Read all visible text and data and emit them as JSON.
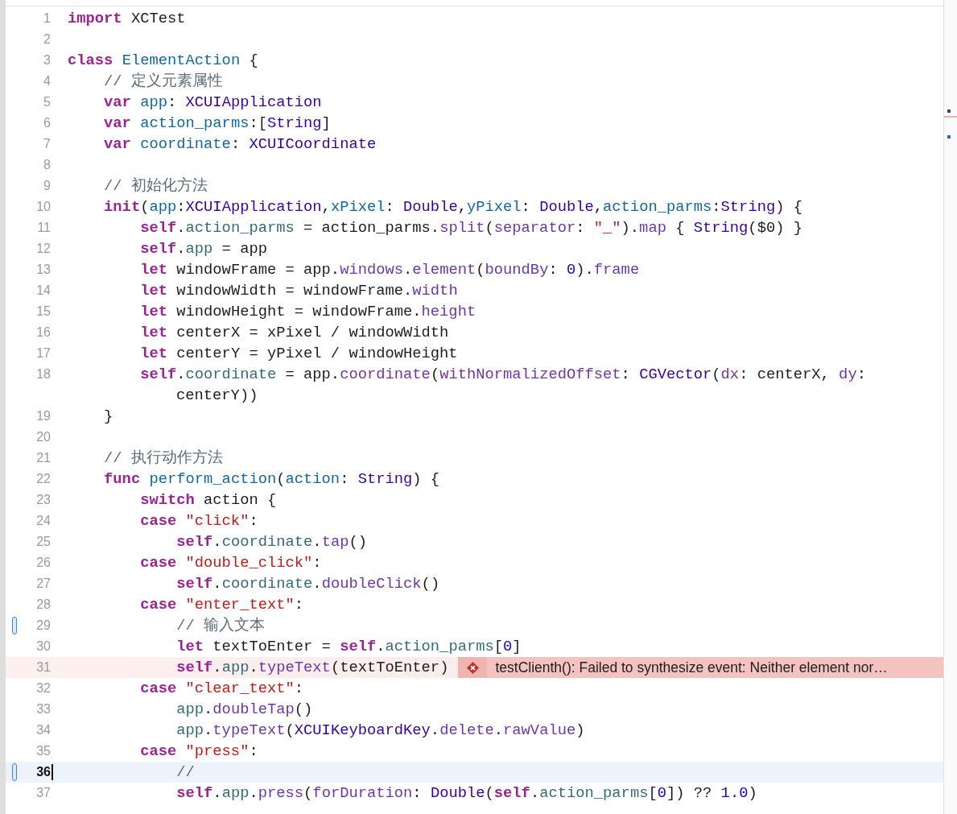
{
  "editor": {
    "lines": [
      {
        "number": "1",
        "changed": false,
        "current": false,
        "tokens": [
          {
            "kind": "keyword",
            "text": "import"
          },
          {
            "kind": "plain",
            "text": " XCTest"
          }
        ]
      },
      {
        "number": "2",
        "changed": false,
        "current": false
      },
      {
        "number": "3",
        "changed": false,
        "current": false,
        "tokens": [
          {
            "kind": "keyword",
            "text": "class"
          },
          {
            "kind": "decl",
            "text": " ElementAction"
          },
          {
            "kind": "plain",
            "text": " {"
          }
        ]
      },
      {
        "number": "4",
        "changed": false,
        "current": false,
        "tokens": [
          {
            "kind": "comment",
            "text": "    // 定义元素属性"
          }
        ]
      },
      {
        "number": "5",
        "changed": false,
        "current": false,
        "tokens": [
          {
            "kind": "keyword",
            "text": "    var"
          },
          {
            "kind": "decl",
            "text": " app"
          },
          {
            "kind": "plain",
            "text": ": "
          },
          {
            "kind": "type",
            "text": "XCUIApplication"
          }
        ]
      },
      {
        "number": "6",
        "changed": false,
        "current": false,
        "tokens": [
          {
            "kind": "keyword",
            "text": "    var"
          },
          {
            "kind": "decl",
            "text": " action_parms"
          },
          {
            "kind": "plain",
            "text": ":["
          },
          {
            "kind": "type",
            "text": "String"
          },
          {
            "kind": "plain",
            "text": "]"
          }
        ]
      },
      {
        "number": "7",
        "changed": false,
        "current": false,
        "tokens": [
          {
            "kind": "keyword",
            "text": "    var"
          },
          {
            "kind": "decl",
            "text": " coordinate"
          },
          {
            "kind": "plain",
            "text": ": "
          },
          {
            "kind": "type",
            "text": "XCUICoordinate"
          }
        ]
      },
      {
        "number": "8",
        "changed": false,
        "current": false
      },
      {
        "number": "9",
        "changed": false,
        "current": false,
        "tokens": [
          {
            "kind": "comment",
            "text": "    // 初始化方法"
          }
        ]
      },
      {
        "number": "10",
        "changed": false,
        "current": false,
        "tokens": [
          {
            "kind": "keyword",
            "text": "    init"
          },
          {
            "kind": "plain",
            "text": "("
          },
          {
            "kind": "decl",
            "text": "app"
          },
          {
            "kind": "plain",
            "text": ":"
          },
          {
            "kind": "type",
            "text": "XCUIApplication"
          },
          {
            "kind": "plain",
            "text": ","
          },
          {
            "kind": "decl",
            "text": "xPixel"
          },
          {
            "kind": "plain",
            "text": ": "
          },
          {
            "kind": "type",
            "text": "Double"
          },
          {
            "kind": "plain",
            "text": ","
          },
          {
            "kind": "decl",
            "text": "yPixel"
          },
          {
            "kind": "plain",
            "text": ": "
          },
          {
            "kind": "type",
            "text": "Double"
          },
          {
            "kind": "plain",
            "text": ","
          },
          {
            "kind": "decl",
            "text": "action_parms"
          },
          {
            "kind": "plain",
            "text": ":"
          },
          {
            "kind": "type",
            "text": "String"
          },
          {
            "kind": "plain",
            "text": ") {"
          }
        ]
      },
      {
        "number": "11",
        "changed": false,
        "current": false,
        "tokens": [
          {
            "kind": "keyword",
            "text": "        self"
          },
          {
            "kind": "plain",
            "text": "."
          },
          {
            "kind": "member",
            "text": "action_parms"
          },
          {
            "kind": "plain",
            "text": " = action_parms."
          },
          {
            "kind": "api",
            "text": "split"
          },
          {
            "kind": "plain",
            "text": "("
          },
          {
            "kind": "api",
            "text": "separator"
          },
          {
            "kind": "plain",
            "text": ": "
          },
          {
            "kind": "string",
            "text": "\"_\""
          },
          {
            "kind": "plain",
            "text": ")."
          },
          {
            "kind": "api",
            "text": "map"
          },
          {
            "kind": "plain",
            "text": " { "
          },
          {
            "kind": "type",
            "text": "String"
          },
          {
            "kind": "plain",
            "text": "($0) }"
          }
        ]
      },
      {
        "number": "12",
        "changed": false,
        "current": false,
        "tokens": [
          {
            "kind": "keyword",
            "text": "        self"
          },
          {
            "kind": "plain",
            "text": "."
          },
          {
            "kind": "member",
            "text": "app"
          },
          {
            "kind": "plain",
            "text": " = app"
          }
        ]
      },
      {
        "number": "13",
        "changed": false,
        "current": false,
        "tokens": [
          {
            "kind": "keyword",
            "text": "        let"
          },
          {
            "kind": "plain",
            "text": " windowFrame = app."
          },
          {
            "kind": "api",
            "text": "windows"
          },
          {
            "kind": "plain",
            "text": "."
          },
          {
            "kind": "api",
            "text": "element"
          },
          {
            "kind": "plain",
            "text": "("
          },
          {
            "kind": "api",
            "text": "boundBy"
          },
          {
            "kind": "plain",
            "text": ": "
          },
          {
            "kind": "number",
            "text": "0"
          },
          {
            "kind": "plain",
            "text": ")."
          },
          {
            "kind": "api",
            "text": "frame"
          }
        ]
      },
      {
        "number": "14",
        "changed": false,
        "current": false,
        "tokens": [
          {
            "kind": "keyword",
            "text": "        let"
          },
          {
            "kind": "plain",
            "text": " windowWidth = windowFrame."
          },
          {
            "kind": "api",
            "text": "width"
          }
        ]
      },
      {
        "number": "15",
        "changed": false,
        "current": false,
        "tokens": [
          {
            "kind": "keyword",
            "text": "        let"
          },
          {
            "kind": "plain",
            "text": " windowHeight = windowFrame."
          },
          {
            "kind": "api",
            "text": "height"
          }
        ]
      },
      {
        "number": "16",
        "changed": false,
        "current": false,
        "tokens": [
          {
            "kind": "keyword",
            "text": "        let"
          },
          {
            "kind": "plain",
            "text": " centerX = xPixel / windowWidth"
          }
        ]
      },
      {
        "number": "17",
        "changed": false,
        "current": false,
        "tokens": [
          {
            "kind": "keyword",
            "text": "        let"
          },
          {
            "kind": "plain",
            "text": " centerY = yPixel / windowHeight"
          }
        ]
      },
      {
        "number": "18",
        "changed": false,
        "current": false,
        "tokens": [
          {
            "kind": "keyword",
            "text": "        self"
          },
          {
            "kind": "plain",
            "text": "."
          },
          {
            "kind": "member",
            "text": "coordinate"
          },
          {
            "kind": "plain",
            "text": " = app."
          },
          {
            "kind": "api",
            "text": "coordinate"
          },
          {
            "kind": "plain",
            "text": "("
          },
          {
            "kind": "api",
            "text": "withNormalizedOffset"
          },
          {
            "kind": "plain",
            "text": ": "
          },
          {
            "kind": "type",
            "text": "CGVector"
          },
          {
            "kind": "plain",
            "text": "("
          },
          {
            "kind": "api",
            "text": "dx"
          },
          {
            "kind": "plain",
            "text": ": centerX, "
          },
          {
            "kind": "api",
            "text": "dy"
          },
          {
            "kind": "plain",
            "text": ":"
          }
        ],
        "wrapped": [
          {
            "kind": "plain",
            "text": "centerY))"
          }
        ]
      },
      {
        "number": "19",
        "changed": false,
        "current": false,
        "tokens": [
          {
            "kind": "plain",
            "text": "    }"
          }
        ]
      },
      {
        "number": "20",
        "changed": false,
        "current": false
      },
      {
        "number": "21",
        "changed": false,
        "current": false,
        "tokens": [
          {
            "kind": "comment",
            "text": "    // 执行动作方法"
          }
        ]
      },
      {
        "number": "22",
        "changed": false,
        "current": false,
        "tokens": [
          {
            "kind": "keyword",
            "text": "    func"
          },
          {
            "kind": "decl",
            "text": " perform_action"
          },
          {
            "kind": "plain",
            "text": "("
          },
          {
            "kind": "decl",
            "text": "action"
          },
          {
            "kind": "plain",
            "text": ": "
          },
          {
            "kind": "type",
            "text": "String"
          },
          {
            "kind": "plain",
            "text": ") {"
          }
        ]
      },
      {
        "number": "23",
        "changed": false,
        "current": false,
        "tokens": [
          {
            "kind": "keyword",
            "text": "        switch"
          },
          {
            "kind": "plain",
            "text": " action {"
          }
        ]
      },
      {
        "number": "24",
        "changed": false,
        "current": false,
        "tokens": [
          {
            "kind": "keyword",
            "text": "        case"
          },
          {
            "kind": "string",
            "text": " \"click\""
          },
          {
            "kind": "plain",
            "text": ":"
          }
        ]
      },
      {
        "number": "25",
        "changed": false,
        "current": false,
        "tokens": [
          {
            "kind": "keyword",
            "text": "            self"
          },
          {
            "kind": "plain",
            "text": "."
          },
          {
            "kind": "member",
            "text": "coordinate"
          },
          {
            "kind": "plain",
            "text": "."
          },
          {
            "kind": "api",
            "text": "tap"
          },
          {
            "kind": "plain",
            "text": "()"
          }
        ]
      },
      {
        "number": "26",
        "changed": false,
        "current": false,
        "tokens": [
          {
            "kind": "keyword",
            "text": "        case"
          },
          {
            "kind": "string",
            "text": " \"double_click\""
          },
          {
            "kind": "plain",
            "text": ":"
          }
        ]
      },
      {
        "number": "27",
        "changed": false,
        "current": false,
        "tokens": [
          {
            "kind": "keyword",
            "text": "            self"
          },
          {
            "kind": "plain",
            "text": "."
          },
          {
            "kind": "member",
            "text": "coordinate"
          },
          {
            "kind": "plain",
            "text": "."
          },
          {
            "kind": "api",
            "text": "doubleClick"
          },
          {
            "kind": "plain",
            "text": "()"
          }
        ]
      },
      {
        "number": "28",
        "changed": false,
        "current": false,
        "tokens": [
          {
            "kind": "keyword",
            "text": "        case"
          },
          {
            "kind": "string",
            "text": " \"enter_text\""
          },
          {
            "kind": "plain",
            "text": ":"
          }
        ]
      },
      {
        "number": "29",
        "changed": true,
        "current": false,
        "tokens": [
          {
            "kind": "comment",
            "text": "            // 输入文本"
          }
        ]
      },
      {
        "number": "30",
        "changed": false,
        "current": false,
        "tokens": [
          {
            "kind": "keyword",
            "text": "            let"
          },
          {
            "kind": "plain",
            "text": " textToEnter = "
          },
          {
            "kind": "keyword",
            "text": "self"
          },
          {
            "kind": "plain",
            "text": "."
          },
          {
            "kind": "member",
            "text": "action_parms"
          },
          {
            "kind": "plain",
            "text": "["
          },
          {
            "kind": "number",
            "text": "0"
          },
          {
            "kind": "plain",
            "text": "]"
          }
        ]
      },
      {
        "number": "31",
        "changed": false,
        "current": false,
        "tokens": [
          {
            "kind": "keyword",
            "text": "            self"
          },
          {
            "kind": "plain",
            "text": "."
          },
          {
            "kind": "member",
            "text": "app"
          },
          {
            "kind": "plain",
            "text": "."
          },
          {
            "kind": "api",
            "text": "typeText"
          },
          {
            "kind": "plain",
            "text": "(textToEnter)"
          }
        ],
        "error": {
          "message": "testClienth(): Failed to synthesize event: Neither element nor…"
        }
      },
      {
        "number": "32",
        "changed": false,
        "current": false,
        "tokens": [
          {
            "kind": "keyword",
            "text": "        case"
          },
          {
            "kind": "string",
            "text": " \"clear_text\""
          },
          {
            "kind": "plain",
            "text": ":"
          }
        ]
      },
      {
        "number": "33",
        "changed": false,
        "current": false,
        "tokens": [
          {
            "kind": "member",
            "text": "            app"
          },
          {
            "kind": "plain",
            "text": "."
          },
          {
            "kind": "api",
            "text": "doubleTap"
          },
          {
            "kind": "plain",
            "text": "()"
          }
        ]
      },
      {
        "number": "34",
        "changed": false,
        "current": false,
        "tokens": [
          {
            "kind": "member",
            "text": "            app"
          },
          {
            "kind": "plain",
            "text": "."
          },
          {
            "kind": "api",
            "text": "typeText"
          },
          {
            "kind": "plain",
            "text": "("
          },
          {
            "kind": "type",
            "text": "XCUIKeyboardKey"
          },
          {
            "kind": "plain",
            "text": "."
          },
          {
            "kind": "api",
            "text": "delete"
          },
          {
            "kind": "plain",
            "text": "."
          },
          {
            "kind": "api",
            "text": "rawValue"
          },
          {
            "kind": "plain",
            "text": ")"
          }
        ]
      },
      {
        "number": "35",
        "changed": false,
        "current": false,
        "tokens": [
          {
            "kind": "keyword",
            "text": "        case"
          },
          {
            "kind": "string",
            "text": " \"press\""
          },
          {
            "kind": "plain",
            "text": ":"
          }
        ]
      },
      {
        "number": "36",
        "changed": true,
        "current": true,
        "tokens": [
          {
            "kind": "comment",
            "text": "            //"
          }
        ]
      },
      {
        "number": "37",
        "changed": false,
        "current": false,
        "tokens": [
          {
            "kind": "keyword",
            "text": "            self"
          },
          {
            "kind": "plain",
            "text": "."
          },
          {
            "kind": "member",
            "text": "app"
          },
          {
            "kind": "plain",
            "text": "."
          },
          {
            "kind": "api",
            "text": "press"
          },
          {
            "kind": "plain",
            "text": "("
          },
          {
            "kind": "api",
            "text": "forDuration"
          },
          {
            "kind": "plain",
            "text": ": "
          },
          {
            "kind": "type",
            "text": "Double"
          },
          {
            "kind": "plain",
            "text": "("
          },
          {
            "kind": "keyword",
            "text": "self"
          },
          {
            "kind": "plain",
            "text": "."
          },
          {
            "kind": "member",
            "text": "action_parms"
          },
          {
            "kind": "plain",
            "text": "["
          },
          {
            "kind": "number",
            "text": "0"
          },
          {
            "kind": "plain",
            "text": "]) ?? "
          },
          {
            "kind": "number",
            "text": "1.0"
          },
          {
            "kind": "plain",
            "text": ")"
          }
        ]
      }
    ]
  }
}
